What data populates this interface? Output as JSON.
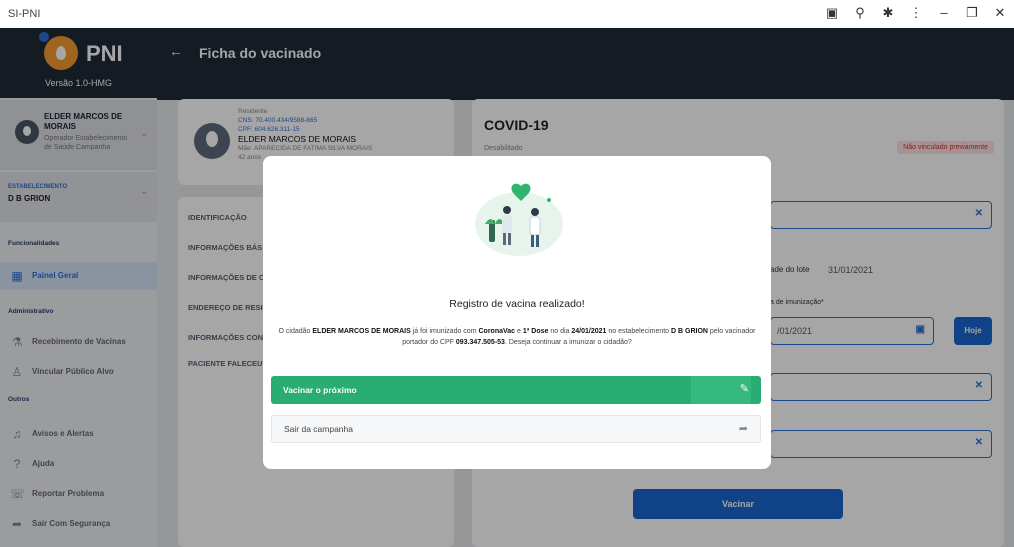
{
  "window": {
    "title": "SI-PNI"
  },
  "sidebar": {
    "logo": "PNI",
    "version": "Versão 1.0-HMG",
    "user": {
      "name": "ELDER MARCOS DE MORAIS",
      "role": "Operador Estabelecimento de Saúde Campanha"
    },
    "establishment": {
      "label": "ESTABELECIMENTO",
      "value": "D B GRION"
    },
    "sections": {
      "funcionalidades": "Funcionalidades",
      "administrativo": "Administrativo",
      "outros": "Outros"
    },
    "items": [
      {
        "label": "Painel Geral",
        "icon": "dashboard-icon"
      },
      {
        "label": "Recebimento de Vacinas",
        "icon": "vaccine-icon"
      },
      {
        "label": "Vincular Público Alvo",
        "icon": "people-icon"
      },
      {
        "label": "Avisos e Alertas",
        "icon": "bell-icon"
      },
      {
        "label": "Ajuda",
        "icon": "help-icon"
      },
      {
        "label": "Reportar Problema",
        "icon": "report-icon"
      },
      {
        "label": "Sair Com Segurança",
        "icon": "logout-icon"
      }
    ]
  },
  "header": {
    "title": "Ficha do vacinado"
  },
  "patient": {
    "line1": "Residente",
    "cns": "CNS: 70.400.434/9588-865",
    "cpf": "CPF: 604.626.311-15",
    "name": "ELDER MARCOS DE MORAIS",
    "mother": "Mãe: APARECIDA DE FATIMA SILVA MORAIS",
    "age": "42 anos"
  },
  "left_menu": [
    "IDENTIFICAÇÃO",
    "INFORMAÇÕES BÁS",
    "INFORMAÇÕES DE C",
    "ENDEREÇO DE RESI",
    "INFORMAÇÕES CON",
    "PACIENTE FALECEU"
  ],
  "campaign": {
    "title": "COVID-19",
    "status": "Desabilitado",
    "badge": "Não vinculado previamente",
    "lote_label": "ade do lote",
    "lote_date": "31/01/2021",
    "imun_label": "a de imunização*",
    "imun_date": "/01/2021",
    "today_button": "Hoje",
    "submit": "Vacinar"
  },
  "modal": {
    "title": "Registro de vacina realizado!",
    "msg_a": "O cidadão ",
    "msg_name": "ELDER MARCOS DE MORAIS",
    "msg_b": " já foi imunizado com ",
    "msg_vaccine": "CoronaVac",
    "msg_c": " e ",
    "msg_dose": "1ª Dose",
    "msg_d": " no dia ",
    "msg_date": "24/01/2021",
    "msg_e": " no estabelecimento ",
    "msg_estab": "D B GRION",
    "msg_f": " pelo vacinador portador do CPF ",
    "msg_cpf": "093.347.505-53",
    "msg_g": ". Deseja continuar a imunizar o cidadão?",
    "next_button": "Vacinar o próximo",
    "exit_button": "Sair da campanha"
  }
}
